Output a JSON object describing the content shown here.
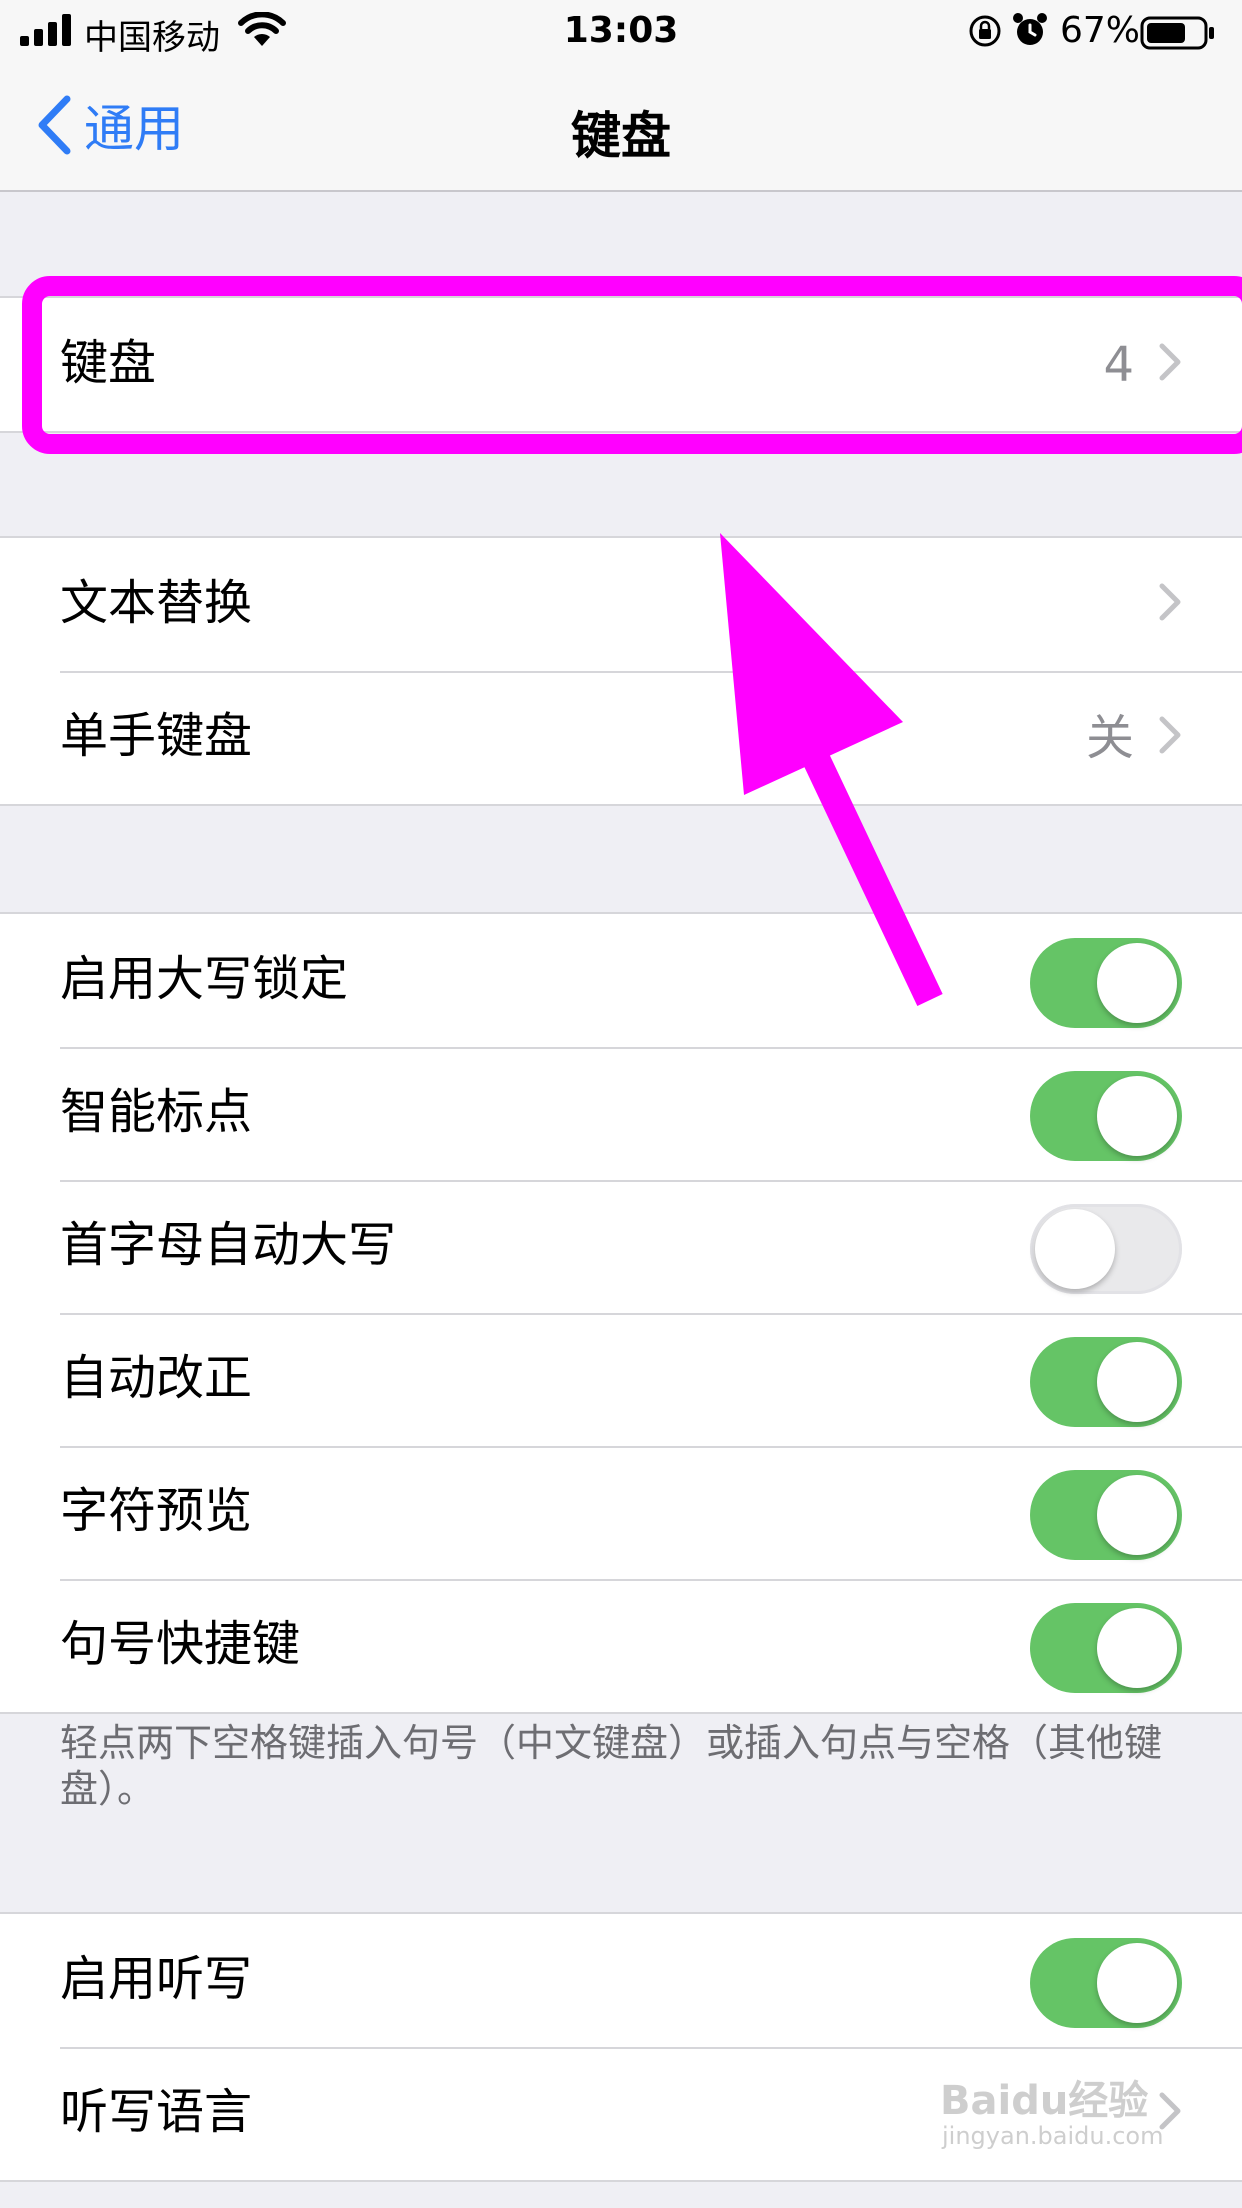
{
  "status_bar": {
    "carrier": "中国移动",
    "time": "13:03",
    "battery_percent": "67%"
  },
  "nav": {
    "back_label": "通用",
    "title": "键盘"
  },
  "groups": {
    "keyboards": {
      "label": "键盘",
      "value": "4"
    },
    "text_replacement": {
      "label": "文本替换"
    },
    "one_handed_keyboard": {
      "label": "单手键盘",
      "value": "关"
    },
    "toggles": [
      {
        "label": "启用大写锁定",
        "on": true
      },
      {
        "label": "智能标点",
        "on": true
      },
      {
        "label": "首字母自动大写",
        "on": false
      },
      {
        "label": "自动改正",
        "on": true
      },
      {
        "label": "字符预览",
        "on": true
      },
      {
        "label": "句号快捷键",
        "on": true
      }
    ],
    "period_shortcut_footer": "轻点两下空格键插入句号（中文键盘）或插入句点与空格（其他键盘）。",
    "dictation": {
      "label": "启用听写",
      "on": true
    },
    "dictation_languages": {
      "label": "听写语言"
    }
  },
  "watermark": {
    "text": "Baidu经验",
    "sub": "jingyan.baidu.com"
  },
  "colors": {
    "accent_blue": "#2f7cf6",
    "toggle_on": "#65c466",
    "annotation_magenta": "#ff00ff"
  }
}
